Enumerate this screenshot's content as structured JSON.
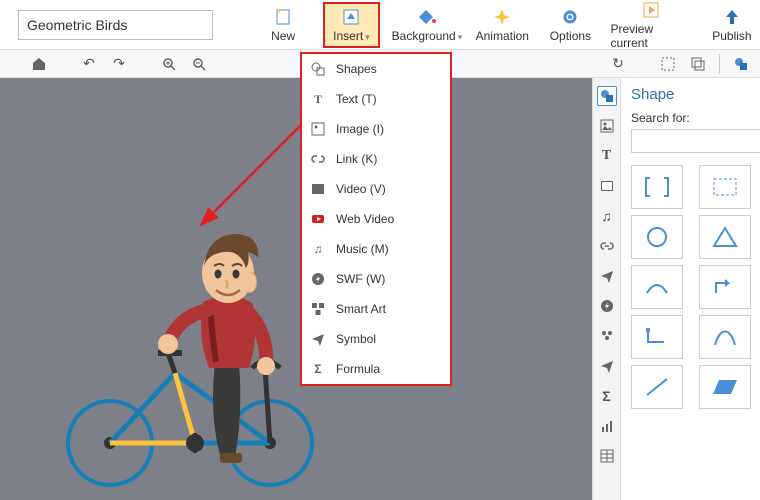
{
  "doc": {
    "title": "Geometric Birds"
  },
  "ribbon": {
    "new": "New",
    "insert": "Insert",
    "background": "Background",
    "animation": "Animation",
    "options": "Options",
    "preview": "Preview current",
    "publish": "Publish"
  },
  "insert_menu": {
    "shapes": "Shapes",
    "text": "Text (T)",
    "image": "Image (I)",
    "link": "Link (K)",
    "video": "Video (V)",
    "webvideo": "Web Video",
    "music": "Music (M)",
    "swf": "SWF (W)",
    "smartart": "Smart Art",
    "symbol": "Symbol",
    "formula": "Formula"
  },
  "shape_panel": {
    "title": "Shape",
    "search_label": "Search for:",
    "search_placeholder": ""
  }
}
